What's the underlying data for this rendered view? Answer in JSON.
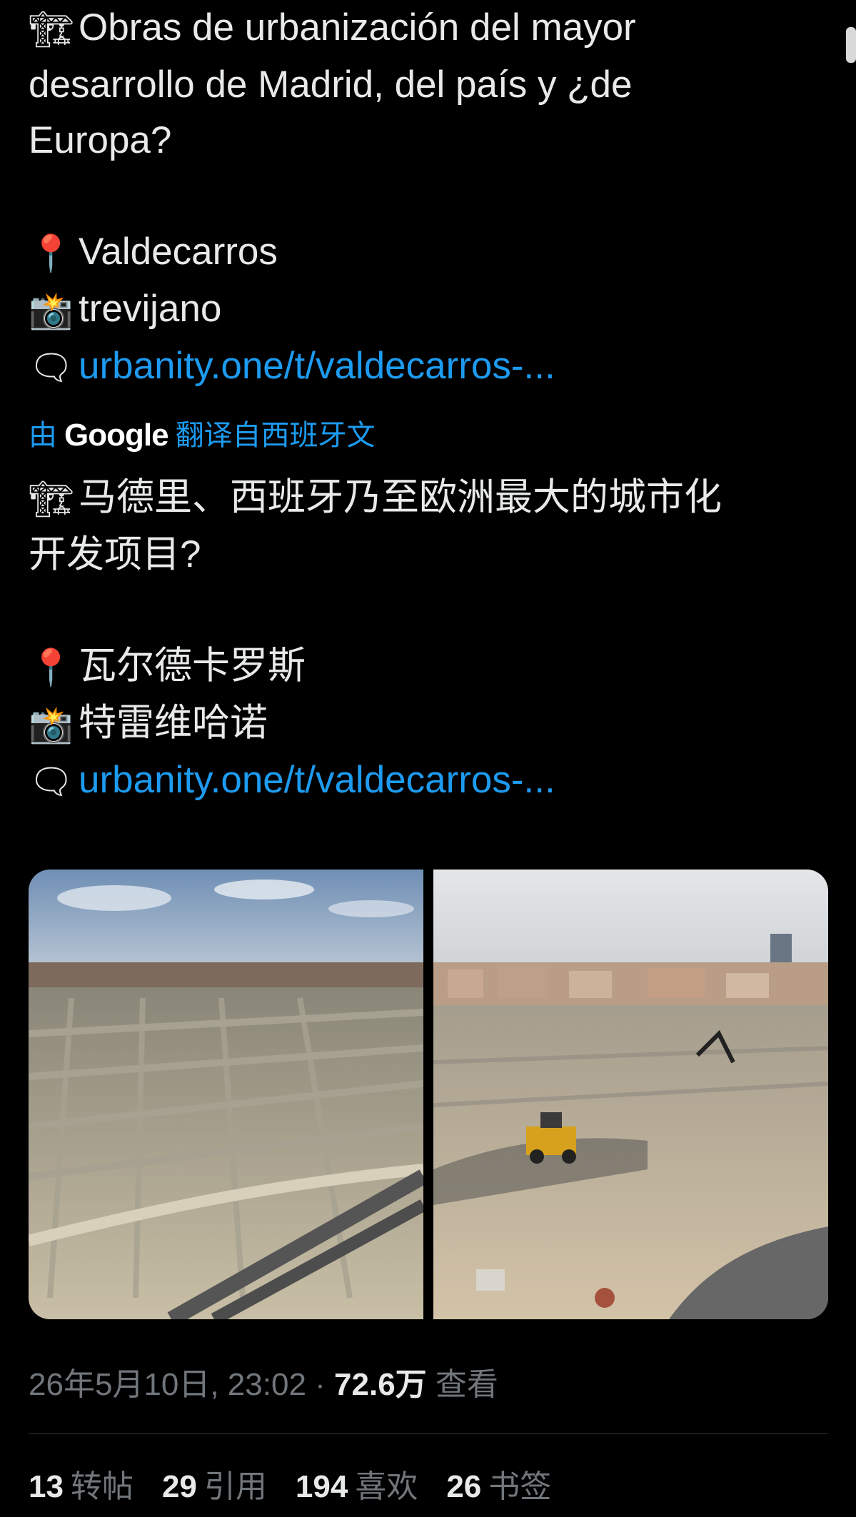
{
  "post": {
    "original": {
      "line1": "Obras de urbanización del mayor",
      "line2": "desarrollo de Madrid, del país y ¿de",
      "line3": "Europa?",
      "location": "Valdecarros",
      "camera": "trevijano",
      "link": "urbanity.one/t/valdecarros-..."
    },
    "translation": {
      "by": "由",
      "brand": "Google",
      "action": "翻译自西班牙文"
    },
    "translated": {
      "line1": "马德里、西班牙乃至欧洲最大的城市化",
      "line2": "开发项目?",
      "location": "瓦尔德卡罗斯",
      "camera": "特雷维哈诺",
      "link": "urbanity.one/t/valdecarros-..."
    },
    "icons": {
      "crane": "🏗",
      "pin": "📍",
      "camera": "📸",
      "speech": "🗨"
    },
    "meta": {
      "datetime": "26年5月10日, 23:02",
      "separator": "·",
      "views": "72.6万",
      "views_label": "查看"
    },
    "stats": [
      {
        "count": "13",
        "label": "转帖"
      },
      {
        "count": "29",
        "label": "引用"
      },
      {
        "count": "194",
        "label": "喜欢"
      },
      {
        "count": "26",
        "label": "书签"
      }
    ]
  },
  "colors": {
    "background": "#000000",
    "text": "#e7e9ea",
    "muted": "#71767b",
    "link": "#1d9bf0",
    "divider": "#2f3336"
  }
}
